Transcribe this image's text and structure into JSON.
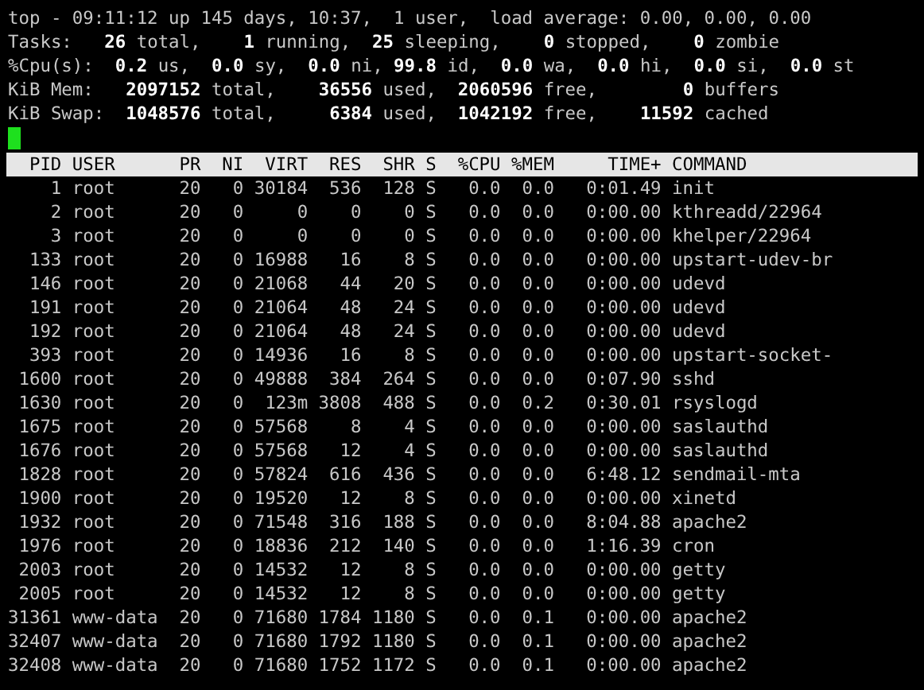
{
  "summary": [
    "top - 09:11:12 up 145 days, 10:37,  1 user,  load average: 0.00, 0.00, 0.00",
    "Tasks:   **26** total,    **1** running,  **25** sleeping,    **0** stopped,    **0** zombie",
    "%Cpu(s):  **0.2** us,  **0.0** sy,  **0.0** ni, **99.8** id,  **0.0** wa,  **0.0** hi,  **0.0** si,  **0.0** st",
    "KiB Mem:   **2097152** total,    **36556** used,  **2060596** free,        **0** buffers",
    "KiB Swap:  **1048576** total,     **6384** used,  **1042192** free,    **11592** cached"
  ],
  "table": {
    "columns": [
      "PID",
      "USER",
      "PR",
      "NI",
      "VIRT",
      "RES",
      "SHR",
      "S",
      "%CPU",
      "%MEM",
      "TIME+",
      "COMMAND"
    ],
    "rows": [
      [
        "1",
        "root",
        "20",
        "0",
        "30184",
        "536",
        "128",
        "S",
        "0.0",
        "0.0",
        "0:01.49",
        "init"
      ],
      [
        "2",
        "root",
        "20",
        "0",
        "0",
        "0",
        "0",
        "S",
        "0.0",
        "0.0",
        "0:00.00",
        "kthreadd/22964"
      ],
      [
        "3",
        "root",
        "20",
        "0",
        "0",
        "0",
        "0",
        "S",
        "0.0",
        "0.0",
        "0:00.00",
        "khelper/22964"
      ],
      [
        "133",
        "root",
        "20",
        "0",
        "16988",
        "16",
        "8",
        "S",
        "0.0",
        "0.0",
        "0:00.00",
        "upstart-udev-br"
      ],
      [
        "146",
        "root",
        "20",
        "0",
        "21068",
        "44",
        "20",
        "S",
        "0.0",
        "0.0",
        "0:00.00",
        "udevd"
      ],
      [
        "191",
        "root",
        "20",
        "0",
        "21064",
        "48",
        "24",
        "S",
        "0.0",
        "0.0",
        "0:00.00",
        "udevd"
      ],
      [
        "192",
        "root",
        "20",
        "0",
        "21064",
        "48",
        "24",
        "S",
        "0.0",
        "0.0",
        "0:00.00",
        "udevd"
      ],
      [
        "393",
        "root",
        "20",
        "0",
        "14936",
        "16",
        "8",
        "S",
        "0.0",
        "0.0",
        "0:00.00",
        "upstart-socket-"
      ],
      [
        "1600",
        "root",
        "20",
        "0",
        "49888",
        "384",
        "264",
        "S",
        "0.0",
        "0.0",
        "0:07.90",
        "sshd"
      ],
      [
        "1630",
        "root",
        "20",
        "0",
        "123m",
        "3808",
        "488",
        "S",
        "0.0",
        "0.2",
        "0:30.01",
        "rsyslogd"
      ],
      [
        "1675",
        "root",
        "20",
        "0",
        "57568",
        "8",
        "4",
        "S",
        "0.0",
        "0.0",
        "0:00.00",
        "saslauthd"
      ],
      [
        "1676",
        "root",
        "20",
        "0",
        "57568",
        "12",
        "4",
        "S",
        "0.0",
        "0.0",
        "0:00.00",
        "saslauthd"
      ],
      [
        "1828",
        "root",
        "20",
        "0",
        "57824",
        "616",
        "436",
        "S",
        "0.0",
        "0.0",
        "6:48.12",
        "sendmail-mta"
      ],
      [
        "1900",
        "root",
        "20",
        "0",
        "19520",
        "12",
        "8",
        "S",
        "0.0",
        "0.0",
        "0:00.00",
        "xinetd"
      ],
      [
        "1932",
        "root",
        "20",
        "0",
        "71548",
        "316",
        "188",
        "S",
        "0.0",
        "0.0",
        "8:04.88",
        "apache2"
      ],
      [
        "1976",
        "root",
        "20",
        "0",
        "18836",
        "212",
        "140",
        "S",
        "0.0",
        "0.0",
        "1:16.39",
        "cron"
      ],
      [
        "2003",
        "root",
        "20",
        "0",
        "14532",
        "12",
        "8",
        "S",
        "0.0",
        "0.0",
        "0:00.00",
        "getty"
      ],
      [
        "2005",
        "root",
        "20",
        "0",
        "14532",
        "12",
        "8",
        "S",
        "0.0",
        "0.0",
        "0:00.00",
        "getty"
      ],
      [
        "31361",
        "www-data",
        "20",
        "0",
        "71680",
        "1784",
        "1180",
        "S",
        "0.0",
        "0.1",
        "0:00.00",
        "apache2"
      ],
      [
        "32407",
        "www-data",
        "20",
        "0",
        "71680",
        "1792",
        "1180",
        "S",
        "0.0",
        "0.1",
        "0:00.00",
        "apache2"
      ],
      [
        "32408",
        "www-data",
        "20",
        "0",
        "71680",
        "1752",
        "1172",
        "S",
        "0.0",
        "0.1",
        "0:00.00",
        "apache2"
      ]
    ]
  }
}
